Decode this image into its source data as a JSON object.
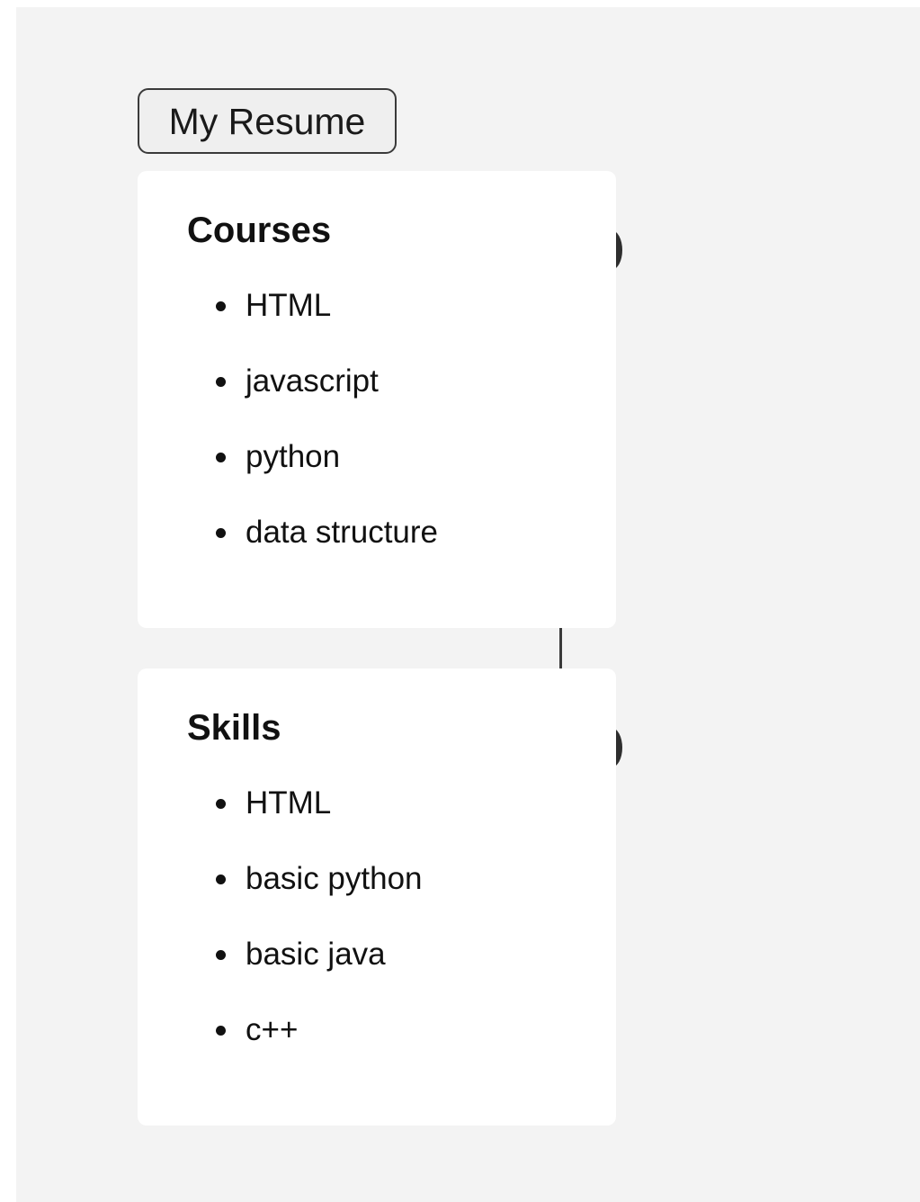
{
  "header": {
    "title_button_label": "My Resume"
  },
  "sections": {
    "courses": {
      "heading": "Courses",
      "items": [
        "HTML",
        "javascript",
        "python",
        "data structure"
      ]
    },
    "skills": {
      "heading": "Skills",
      "items": [
        "HTML",
        "basic python",
        "basic java",
        "c++"
      ]
    }
  },
  "colors": {
    "page_background": "#f3f3f3",
    "card_background": "#ffffff",
    "text": "#111111",
    "timeline": "#2e2e2e"
  }
}
